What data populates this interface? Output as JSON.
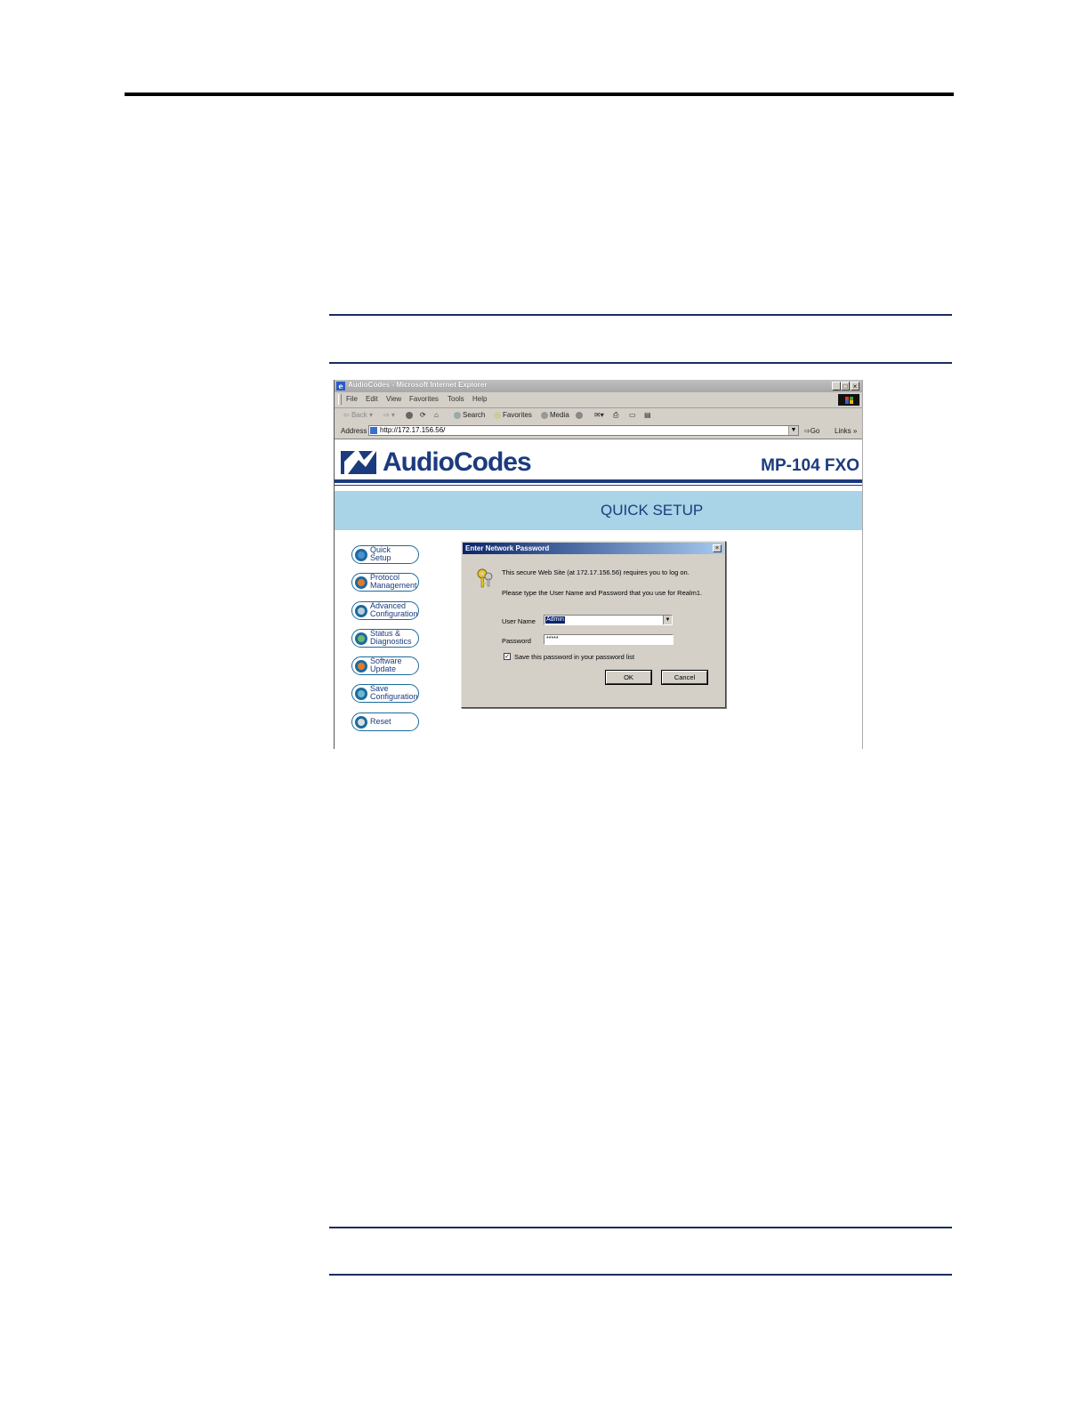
{
  "browser": {
    "window_title": "AudioCodes - Microsoft Internet Explorer",
    "menu": [
      "File",
      "Edit",
      "View",
      "Favorites",
      "Tools",
      "Help"
    ],
    "toolbar": {
      "back": "Back",
      "search": "Search",
      "favorites": "Favorites",
      "media": "Media"
    },
    "address_label": "Address",
    "url": "http://172.17.156.56/",
    "go_label": "Go",
    "links_label": "Links"
  },
  "page": {
    "brand": "AudioCodes",
    "model": "MP-104 FXO",
    "banner": "QUICK SETUP",
    "nav": [
      {
        "label": "Quick\nSetup",
        "icon": "person-icon"
      },
      {
        "label": "Protocol\nManagement",
        "icon": "grid-icon"
      },
      {
        "label": "Advanced\nConfiguration",
        "icon": "wrench-icon"
      },
      {
        "label": "Status &\nDiagnostics",
        "icon": "monitor-icon"
      },
      {
        "label": "Software\nUpdate",
        "icon": "grid-icon"
      },
      {
        "label": "Save\nConfiguration",
        "icon": "disk-icon"
      },
      {
        "label": "Reset",
        "icon": "x-icon"
      }
    ]
  },
  "dialog": {
    "title": "Enter Network Password",
    "line1": "This secure Web Site (at 172.17.156.56) requires you to log on.",
    "line2": "Please type the User Name and Password that you use for Realm1.",
    "username_label": "User Name",
    "username_value": "Admin",
    "password_label": "Password",
    "password_value": "*****",
    "save_label": "Save this password in your password list",
    "save_checked": true,
    "ok_label": "OK",
    "cancel_label": "Cancel"
  },
  "colors": {
    "brand_blue": "#1c3b7e",
    "banner_bg": "#a9d3e6",
    "nav_border": "#1c6a9c",
    "dialog_title": "#0a246a"
  }
}
